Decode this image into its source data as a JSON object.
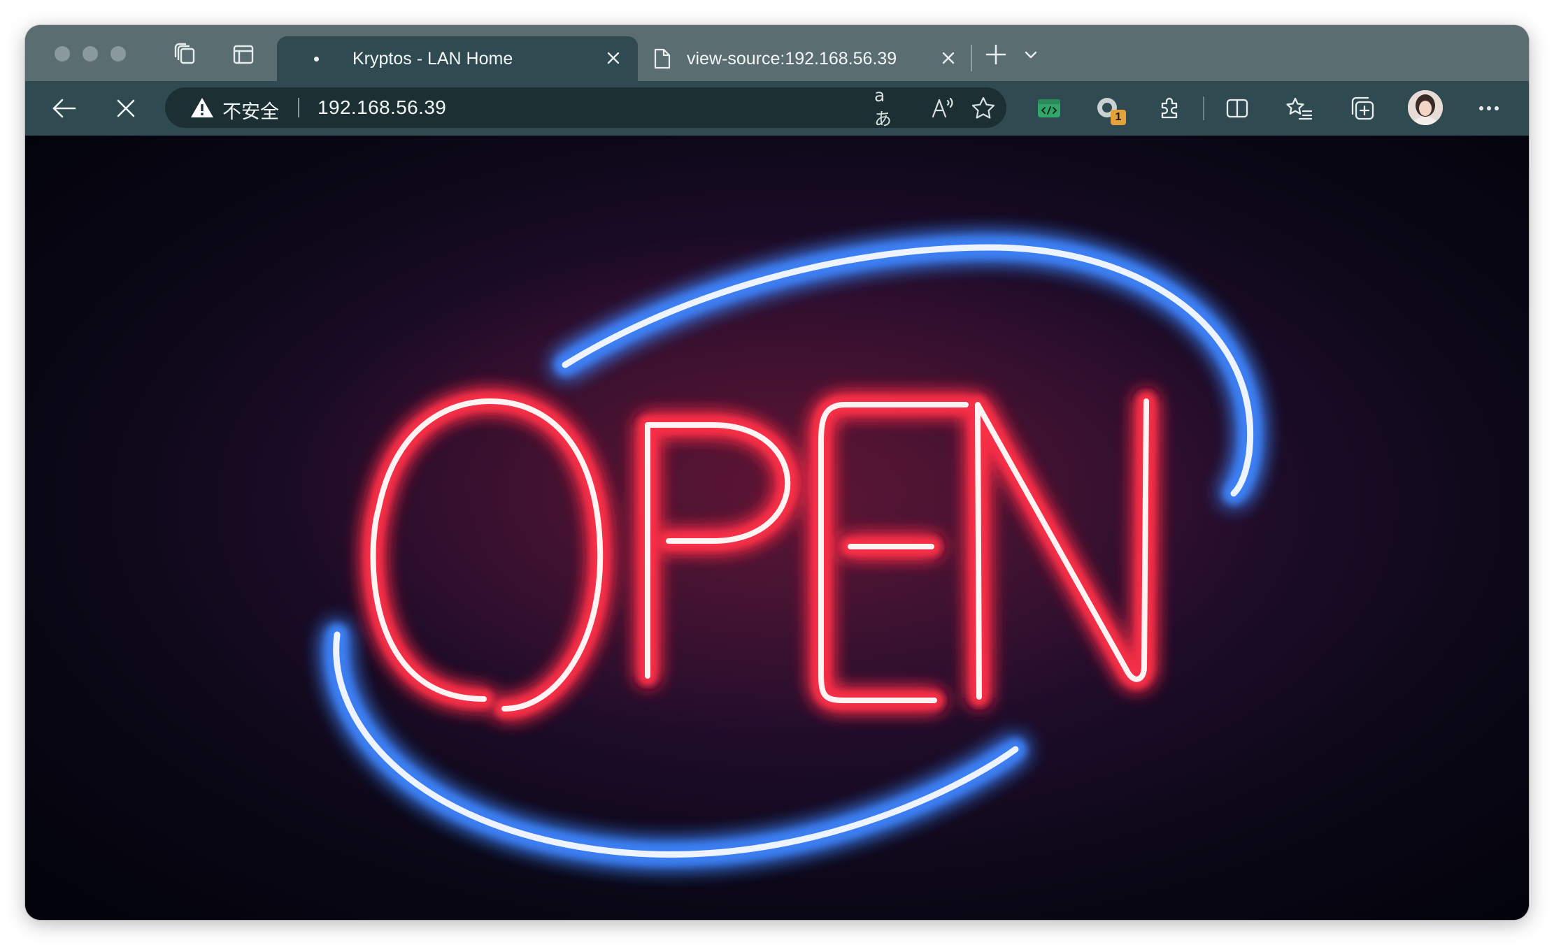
{
  "window": {
    "tabs": [
      {
        "title": "Kryptos - LAN Home",
        "state": "loading",
        "active": true
      },
      {
        "title": "view-source:192.168.56.39",
        "active": false
      }
    ]
  },
  "toolbar": {
    "security_label": "不安全",
    "url": "192.168.56.39",
    "translate_icon_label": "aあ",
    "extension_badge": "1"
  },
  "content": {
    "sign_text": "OPEN",
    "sign_color": "#ff3348",
    "ring_color": "#3f86ff",
    "background_color": "#1a0b22"
  },
  "colors": {
    "tabstrip": "#5a6e71",
    "toolbar": "#2f4a50",
    "omnibox": "#1c2f33",
    "badge": "#e4a23a",
    "dev_extension": "#33a56b"
  }
}
